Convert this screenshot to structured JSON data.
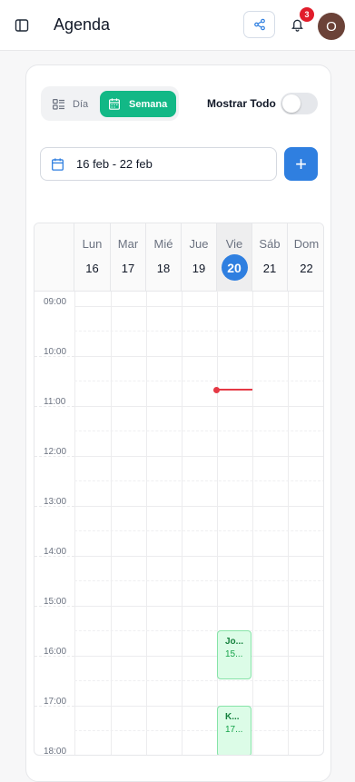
{
  "header": {
    "title": "Agenda",
    "notification_count": "3",
    "avatar_initial": "O"
  },
  "view_toggle": {
    "day_label": "Día",
    "week_label": "Semana",
    "selected": "Semana"
  },
  "show_all": {
    "label": "Mostrar Todo",
    "enabled": false
  },
  "date_range": {
    "label": "16 feb - 22 feb"
  },
  "add_button": {
    "symbol": "+"
  },
  "week": {
    "days": [
      {
        "name": "Lun",
        "number": "16"
      },
      {
        "name": "Mar",
        "number": "17"
      },
      {
        "name": "Mié",
        "number": "18"
      },
      {
        "name": "Jue",
        "number": "19"
      },
      {
        "name": "Vie",
        "number": "20",
        "today": true
      },
      {
        "name": "Sáb",
        "number": "21"
      },
      {
        "name": "Dom",
        "number": "22"
      }
    ],
    "hours": [
      "09:00",
      "10:00",
      "11:00",
      "12:00",
      "13:00",
      "14:00",
      "15:00",
      "16:00",
      "17:00",
      "18:00"
    ]
  },
  "events": [
    {
      "title": "Jo...",
      "time": "15..."
    },
    {
      "title": "K...",
      "time": "17..."
    }
  ],
  "colors": {
    "accent_blue": "#2f7fe0",
    "accent_green": "#12b886",
    "now_indicator": "#e53945",
    "badge_red": "#e11d2b"
  }
}
